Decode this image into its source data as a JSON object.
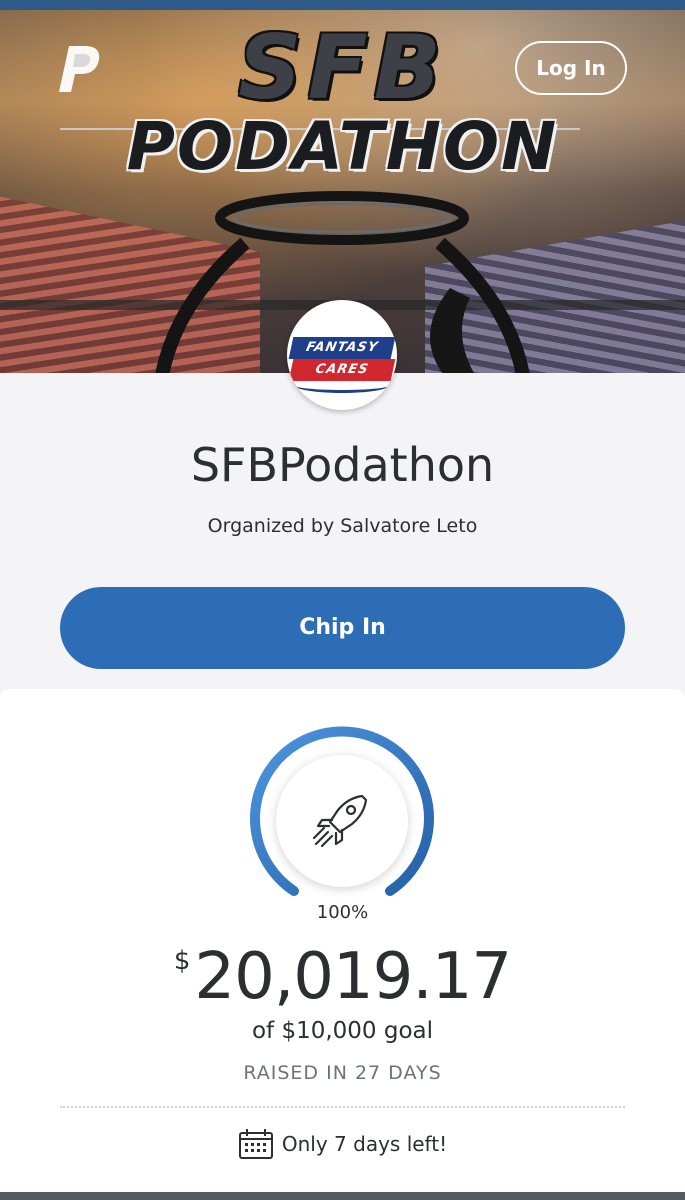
{
  "header": {
    "brand_icon": "paypal-logo-icon",
    "login_label": "Log In"
  },
  "hero": {
    "title_line1": "SFB",
    "title_line2": "PODATHON"
  },
  "avatar": {
    "logo_top": "FANTASY",
    "logo_bottom": "CARES"
  },
  "campaign": {
    "title": "SFBPodathon",
    "organizer": "Organized by Salvatore Leto",
    "cta_label": "Chip In"
  },
  "progress": {
    "percent_label": "100%",
    "percent_value": 100,
    "currency_symbol": "$",
    "amount": "20,019.17",
    "goal_text": "of $10,000 goal",
    "raised_text": "RAISED IN 27 DAYS",
    "days_left_text": "Only 7 days left!",
    "icon": "rocket-icon",
    "ring_color": "#2d6db5"
  },
  "colors": {
    "primary": "#2d6db5",
    "text": "#2c2e2f",
    "muted": "#6c7378"
  }
}
